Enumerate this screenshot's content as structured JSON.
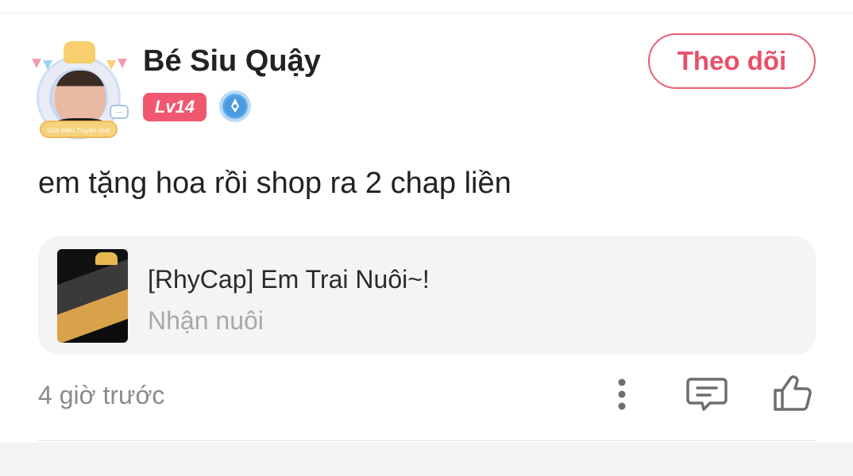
{
  "post": {
    "author": {
      "name": "Bé Siu Quậy",
      "level": "Lv14",
      "avatar_frame_caption": "Giới thiệu Truyện chat",
      "avatar_bubble_text": "..."
    },
    "follow_label": "Theo dõi",
    "comment_text": "em tặng hoa rồi shop ra 2 chap liền",
    "linked_story": {
      "title": "[RhyCap] Em Trai Nuôi~!",
      "subtitle": "Nhận nuôi"
    },
    "time_ago": "4 giờ trước",
    "actions": [
      {
        "icon": "more-vertical-icon"
      },
      {
        "icon": "comment-icon"
      },
      {
        "icon": "thumbs-up-icon"
      }
    ]
  },
  "colors": {
    "accent": "#e8506a",
    "level_badge": "#f0586f",
    "card_bg": "#f4f4f4",
    "muted_text": "#8b8b8b",
    "creator_badge": "#4a9be0"
  }
}
